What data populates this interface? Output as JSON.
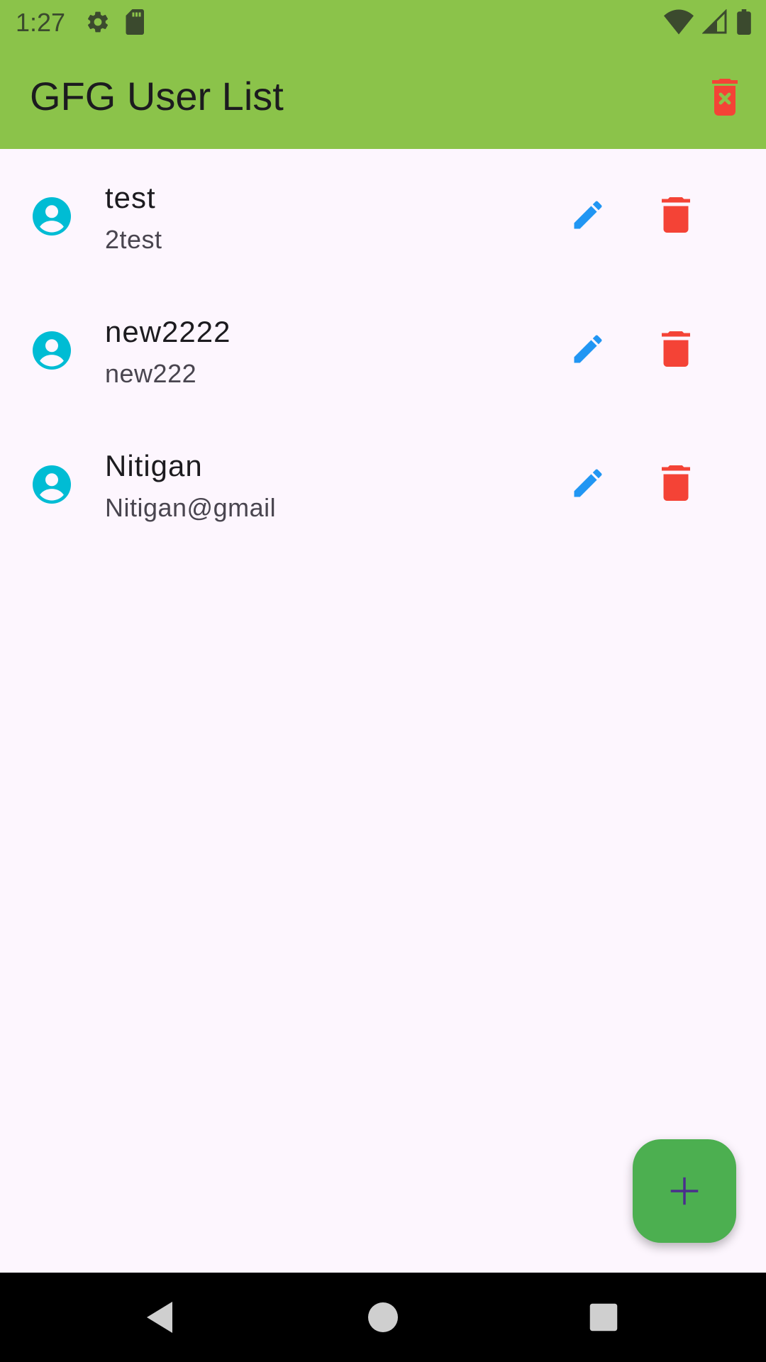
{
  "status_bar": {
    "time": "1:27",
    "left_icons": [
      "gear-icon",
      "sd-card-icon"
    ],
    "right_icons": [
      "wifi-icon",
      "cell-signal-icon",
      "battery-icon"
    ]
  },
  "app_bar": {
    "title": "GFG User List",
    "action_icon": "delete-forever-icon"
  },
  "users": [
    {
      "name": "test",
      "subtitle": "2test"
    },
    {
      "name": "new2222",
      "subtitle": "new222"
    },
    {
      "name": "Nitigan",
      "subtitle": "Nitigan@gmail"
    }
  ],
  "fab": {
    "icon": "plus-icon"
  },
  "nav_bar": {
    "buttons": [
      "back-icon",
      "home-icon",
      "recents-icon"
    ]
  },
  "colors": {
    "app_bar": "#8bc34a",
    "background": "#fdf6fe",
    "avatar": "#00bcd4",
    "edit": "#2196f3",
    "delete": "#f44336",
    "fab": "#4caf50",
    "fab_icon": "#4a2e8c"
  }
}
